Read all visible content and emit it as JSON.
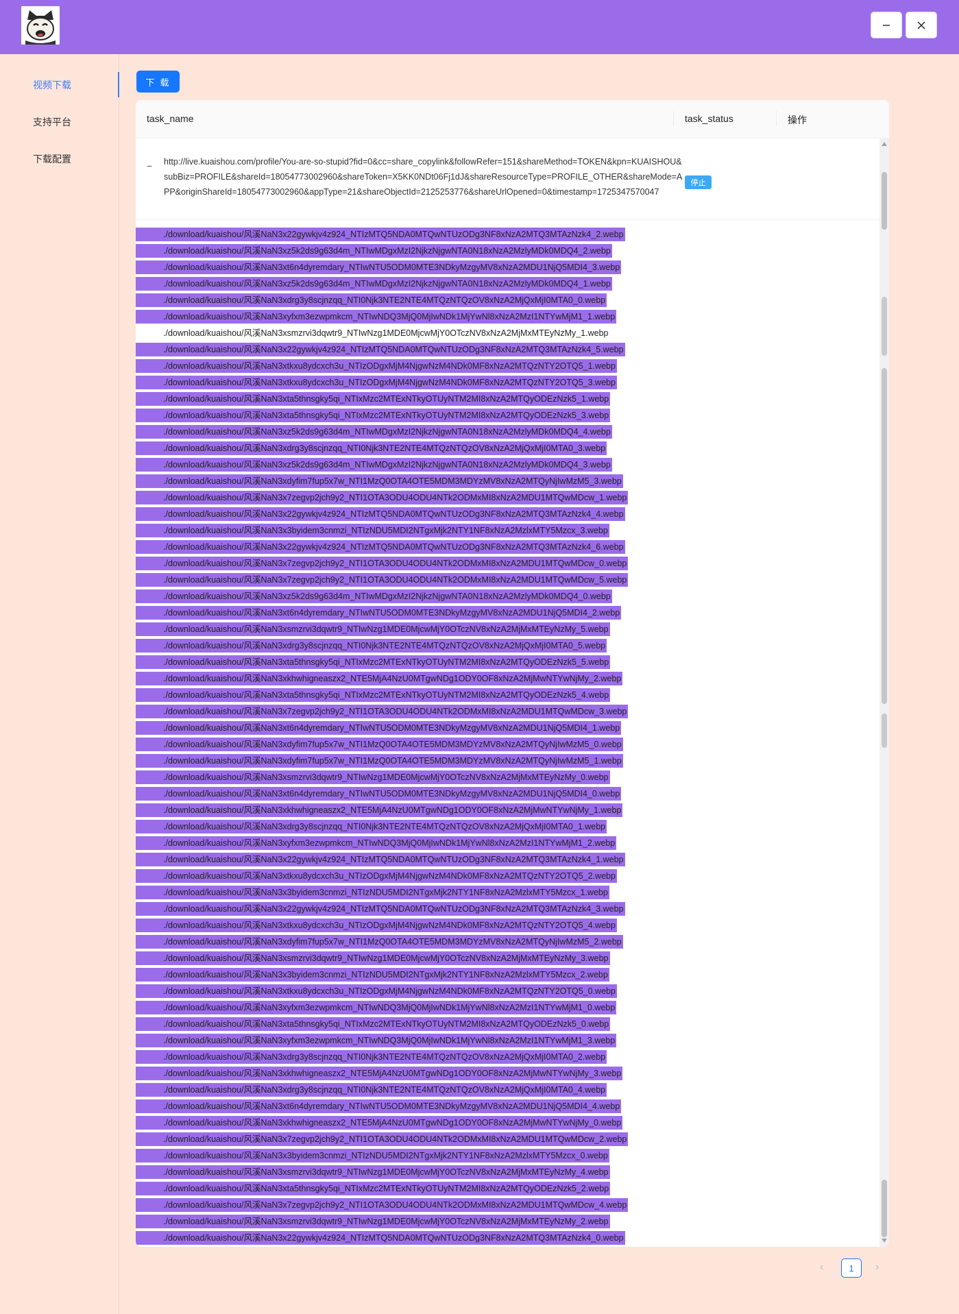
{
  "header": {
    "close_icon": "close-icon",
    "minimize_icon": "minimize-icon"
  },
  "sidebar": {
    "items": [
      {
        "label": "视频下载",
        "active": true
      },
      {
        "label": "支持平台",
        "active": false
      },
      {
        "label": "下载配置",
        "active": false
      }
    ]
  },
  "toolbar": {
    "download_label": "下 载"
  },
  "table": {
    "columns": [
      "task_name",
      "task_status",
      "操作"
    ],
    "task": {
      "name": "http://live.kuaishou.com/profile/You-are-so-stupid?fid=0&cc=share_copylink&followRefer=151&shareMethod=TOKEN&kpn=KUAISHOU&subBiz=PROFILE&shareId=18054773002960&shareToken=X5KK0NDt06Fj1dJ&shareResourceType=PROFILE_OTHER&shareMode=APP&originShareId=18054773002960&appType=21&shareObjectId=2125253776&shareUrlOpened=0&timestamp=1725347570047",
      "status": "停止",
      "collapse_symbol": "−"
    },
    "files": [
      {
        "path": "./download/kuaishou/风溪NaN3x22gywkjv4z924_NTIzMTQ5NDA0MTQwNTUzODg3NF8xNzA2MTQ3MTAzNzk4_2.webp",
        "selected": true
      },
      {
        "path": "./download/kuaishou/风溪NaN3xz5k2ds9g63d4m_NTIwMDgxMzI2NjkzNjgwNTA0N18xNzA2MzlyMDk0MDQ4_2.webp",
        "selected": true
      },
      {
        "path": "./download/kuaishou/风溪NaN3xt6n4dyremdary_NTIwNTU5ODM0MTE3NDkyMzgyMV8xNzA2MDU1NjQ5MDI4_3.webp",
        "selected": true
      },
      {
        "path": "./download/kuaishou/风溪NaN3xz5k2ds9g63d4m_NTIwMDgxMzI2NjkzNjgwNTA0N18xNzA2MzlyMDk0MDQ4_1.webp",
        "selected": true
      },
      {
        "path": "./download/kuaishou/风溪NaN3xdrg3y8scjnzqq_NTI0Njk3NTE2NTE4MTQzNTQzOV8xNzA2MjQxMjI0MTA0_0.webp",
        "selected": true
      },
      {
        "path": "./download/kuaishou/风溪NaN3xyfxm3ezwpmkcm_NTIwNDQ3MjQ0MjIwNDk1MjYwNl8xNzA2MzI1NTYwMjM1_1.webp",
        "selected": true
      },
      {
        "path": "./download/kuaishou/风溪NaN3xsmzrvi3dqwtr9_NTIwNzg1MDE0MjcwMjY0OTczNV8xNzA2MjMxMTEyNzMy_1.webp",
        "selected": false
      },
      {
        "path": "./download/kuaishou/风溪NaN3x22gywkjv4z924_NTIzMTQ5NDA0MTQwNTUzODg3NF8xNzA2MTQ3MTAzNzk4_5.webp",
        "selected": true
      },
      {
        "path": "./download/kuaishou/风溪NaN3xtkxu8ydcxch3u_NTIzODgxMjM4NjgwNzM4NDk0MF8xNzA2MTQzNTY2OTQ5_1.webp",
        "selected": true
      },
      {
        "path": "./download/kuaishou/风溪NaN3xtkxu8ydcxch3u_NTIzODgxMjM4NjgwNzM4NDk0MF8xNzA2MTQzNTY2OTQ5_3.webp",
        "selected": true
      },
      {
        "path": "./download/kuaishou/风溪NaN3xta5thnsgky5qi_NTIxMzc2MTExNTkyOTUyNTM2MI8xNzA2MTQyODEzNzk5_1.webp",
        "selected": true
      },
      {
        "path": "./download/kuaishou/风溪NaN3xta5thnsgky5qi_NTIxMzc2MTExNTkyOTUyNTM2MI8xNzA2MTQyODEzNzk5_3.webp",
        "selected": true
      },
      {
        "path": "./download/kuaishou/风溪NaN3xz5k2ds9g63d4m_NTIwMDgxMzI2NjkzNjgwNTA0N18xNzA2MzlyMDk0MDQ4_4.webp",
        "selected": true
      },
      {
        "path": "./download/kuaishou/风溪NaN3xdrg3y8scjnzqq_NTI0Njk3NTE2NTE4MTQzNTQzOV8xNzA2MjQxMjI0MTA0_3.webp",
        "selected": true
      },
      {
        "path": "./download/kuaishou/风溪NaN3xz5k2ds9g63d4m_NTIwMDgxMzI2NjkzNjgwNTA0N18xNzA2MzlyMDk0MDQ4_3.webp",
        "selected": true
      },
      {
        "path": "./download/kuaishou/风溪NaN3xdyfim7fup5x7w_NTI1MzQ0OTA4OTE5MDM3MDYzMV8xNzA2MTQyNjIwMzM5_3.webp",
        "selected": true
      },
      {
        "path": "./download/kuaishou/风溪NaN3x7zegvp2jch9y2_NTI1OTA3ODU4ODU4NTk2ODMxMI8xNzA2MDU1MTQwMDcw_1.webp",
        "selected": true
      },
      {
        "path": "./download/kuaishou/风溪NaN3x22gywkjv4z924_NTIzMTQ5NDA0MTQwNTUzODg3NF8xNzA2MTQ3MTAzNzk4_4.webp",
        "selected": true
      },
      {
        "path": "./download/kuaishou/风溪NaN3x3byidem3cnmzi_NTIzNDU5MDI2NTgxMjk2NTY1NF8xNzA2MzlxMTY5Mzcx_3.webp",
        "selected": true
      },
      {
        "path": "./download/kuaishou/风溪NaN3x22gywkjv4z924_NTIzMTQ5NDA0MTQwNTUzODg3NF8xNzA2MTQ3MTAzNzk4_6.webp",
        "selected": true
      },
      {
        "path": "./download/kuaishou/风溪NaN3x7zegvp2jch9y2_NTI1OTA3ODU4ODU4NTk2ODMxMI8xNzA2MDU1MTQwMDcw_0.webp",
        "selected": true
      },
      {
        "path": "./download/kuaishou/风溪NaN3x7zegvp2jch9y2_NTI1OTA3ODU4ODU4NTk2ODMxMI8xNzA2MDU1MTQwMDcw_5.webp",
        "selected": true
      },
      {
        "path": "./download/kuaishou/风溪NaN3xz5k2ds9g63d4m_NTIwMDgxMzI2NjkzNjgwNTA0N18xNzA2MzlyMDk0MDQ4_0.webp",
        "selected": true
      },
      {
        "path": "./download/kuaishou/风溪NaN3xt6n4dyremdary_NTIwNTU5ODM0MTE3NDkyMzgyMV8xNzA2MDU1NjQ5MDI4_2.webp",
        "selected": true
      },
      {
        "path": "./download/kuaishou/风溪NaN3xsmzrvi3dqwtr9_NTIwNzg1MDE0MjcwMjY0OTczNV8xNzA2MjMxMTEyNzMy_5.webp",
        "selected": true
      },
      {
        "path": "./download/kuaishou/风溪NaN3xdrg3y8scjnzqq_NTI0Njk3NTE2NTE4MTQzNTQzOV8xNzA2MjQxMjI0MTA0_5.webp",
        "selected": true
      },
      {
        "path": "./download/kuaishou/风溪NaN3xta5thnsgky5qi_NTIxMzc2MTExNTkyOTUyNTM2MI8xNzA2MTQyODEzNzk5_5.webp",
        "selected": true
      },
      {
        "path": "./download/kuaishou/风溪NaN3xkhwhigneaszx2_NTE5MjA4NzU0MTgwNDg1ODY0OF8xNzA2MjMwNTYwNjMy_2.webp",
        "selected": true
      },
      {
        "path": "./download/kuaishou/风溪NaN3xta5thnsgky5qi_NTIxMzc2MTExNTkyOTUyNTM2MI8xNzA2MTQyODEzNzk5_4.webp",
        "selected": true
      },
      {
        "path": "./download/kuaishou/风溪NaN3x7zegvp2jch9y2_NTI1OTA3ODU4ODU4NTk2ODMxMI8xNzA2MDU1MTQwMDcw_3.webp",
        "selected": true
      },
      {
        "path": "./download/kuaishou/风溪NaN3xt6n4dyremdary_NTIwNTU5ODM0MTE3NDkyMzgyMV8xNzA2MDU1NjQ5MDI4_1.webp",
        "selected": true
      },
      {
        "path": "./download/kuaishou/风溪NaN3xdyfim7fup5x7w_NTI1MzQ0OTA4OTE5MDM3MDYzMV8xNzA2MTQyNjIwMzM5_0.webp",
        "selected": true
      },
      {
        "path": "./download/kuaishou/风溪NaN3xdyfim7fup5x7w_NTI1MzQ0OTA4OTE5MDM3MDYzMV8xNzA2MTQyNjIwMzM5_1.webp",
        "selected": true
      },
      {
        "path": "./download/kuaishou/风溪NaN3xsmzrvi3dqwtr9_NTIwNzg1MDE0MjcwMjY0OTczNV8xNzA2MjMxMTEyNzMy_0.webp",
        "selected": true
      },
      {
        "path": "./download/kuaishou/风溪NaN3xt6n4dyremdary_NTIwNTU5ODM0MTE3NDkyMzgyMV8xNzA2MDU1NjQ5MDI4_0.webp",
        "selected": true
      },
      {
        "path": "./download/kuaishou/风溪NaN3xkhwhigneaszx2_NTE5MjA4NzU0MTgwNDg1ODY0OF8xNzA2MjMwNTYwNjMy_1.webp",
        "selected": true
      },
      {
        "path": "./download/kuaishou/风溪NaN3xdrg3y8scjnzqq_NTI0Njk3NTE2NTE4MTQzNTQzOV8xNzA2MjQxMjI0MTA0_1.webp",
        "selected": true
      },
      {
        "path": "./download/kuaishou/风溪NaN3xyfxm3ezwpmkcm_NTIwNDQ3MjQ0MjIwNDk1MjYwNl8xNzA2MzI1NTYwMjM1_2.webp",
        "selected": true
      },
      {
        "path": "./download/kuaishou/风溪NaN3x22gywkjv4z924_NTIzMTQ5NDA0MTQwNTUzODg3NF8xNzA2MTQ3MTAzNzk4_1.webp",
        "selected": true
      },
      {
        "path": "./download/kuaishou/风溪NaN3xtkxu8ydcxch3u_NTIzODgxMjM4NjgwNzM4NDk0MF8xNzA2MTQzNTY2OTQ5_2.webp",
        "selected": true
      },
      {
        "path": "./download/kuaishou/风溪NaN3x3byidem3cnmzi_NTIzNDU5MDI2NTgxMjk2NTY1NF8xNzA2MzlxMTY5Mzcx_1.webp",
        "selected": true
      },
      {
        "path": "./download/kuaishou/风溪NaN3x22gywkjv4z924_NTIzMTQ5NDA0MTQwNTUzODg3NF8xNzA2MTQ3MTAzNzk4_3.webp",
        "selected": true
      },
      {
        "path": "./download/kuaishou/风溪NaN3xtkxu8ydcxch3u_NTIzODgxMjM4NjgwNzM4NDk0MF8xNzA2MTQzNTY2OTQ5_4.webp",
        "selected": true
      },
      {
        "path": "./download/kuaishou/风溪NaN3xdyfim7fup5x7w_NTI1MzQ0OTA4OTE5MDM3MDYzMV8xNzA2MTQyNjIwMzM5_2.webp",
        "selected": true
      },
      {
        "path": "./download/kuaishou/风溪NaN3xsmzrvi3dqwtr9_NTIwNzg1MDE0MjcwMjY0OTczNV8xNzA2MjMxMTEyNzMy_3.webp",
        "selected": true
      },
      {
        "path": "./download/kuaishou/风溪NaN3x3byidem3cnmzi_NTIzNDU5MDI2NTgxMjk2NTY1NF8xNzA2MzlxMTY5Mzcx_2.webp",
        "selected": true
      },
      {
        "path": "./download/kuaishou/风溪NaN3xtkxu8ydcxch3u_NTIzODgxMjM4NjgwNzM4NDk0MF8xNzA2MTQzNTY2OTQ5_0.webp",
        "selected": true
      },
      {
        "path": "./download/kuaishou/风溪NaN3xyfxm3ezwpmkcm_NTIwNDQ3MjQ0MjIwNDk1MjYwNl8xNzA2MzI1NTYwMjM1_0.webp",
        "selected": true
      },
      {
        "path": "./download/kuaishou/风溪NaN3xta5thnsgky5qi_NTIxMzc2MTExNTkyOTUyNTM2MI8xNzA2MTQyODEzNzk5_0.webp",
        "selected": true
      },
      {
        "path": "./download/kuaishou/风溪NaN3xyfxm3ezwpmkcm_NTIwNDQ3MjQ0MjIwNDk1MjYwNl8xNzA2MzI1NTYwMjM1_3.webp",
        "selected": true
      },
      {
        "path": "./download/kuaishou/风溪NaN3xdrg3y8scjnzqq_NTI0Njk3NTE2NTE4MTQzNTQzOV8xNzA2MjQxMjI0MTA0_2.webp",
        "selected": true
      },
      {
        "path": "./download/kuaishou/风溪NaN3xkhwhigneaszx2_NTE5MjA4NzU0MTgwNDg1ODY0OF8xNzA2MjMwNTYwNjMy_3.webp",
        "selected": true
      },
      {
        "path": "./download/kuaishou/风溪NaN3xdrg3y8scjnzqq_NTI0Njk3NTE2NTE4MTQzNTQzOV8xNzA2MjQxMjI0MTA0_4.webp",
        "selected": true
      },
      {
        "path": "./download/kuaishou/风溪NaN3xt6n4dyremdary_NTIwNTU5ODM0MTE3NDkyMzgyMV8xNzA2MDU1NjQ5MDI4_4.webp",
        "selected": true
      },
      {
        "path": "./download/kuaishou/风溪NaN3xkhwhigneaszx2_NTE5MjA4NzU0MTgwNDg1ODY0OF8xNzA2MjMwNTYwNjMy_0.webp",
        "selected": true
      },
      {
        "path": "./download/kuaishou/风溪NaN3x7zegvp2jch9y2_NTI1OTA3ODU4ODU4NTk2ODMxMI8xNzA2MDU1MTQwMDcw_2.webp",
        "selected": true
      },
      {
        "path": "./download/kuaishou/风溪NaN3x3byidem3cnmzi_NTIzNDU5MDI2NTgxMjk2NTY1NF8xNzA2MzlxMTY5Mzcx_0.webp",
        "selected": true
      },
      {
        "path": "./download/kuaishou/风溪NaN3xsmzrvi3dqwtr9_NTIwNzg1MDE0MjcwMjY0OTczNV8xNzA2MjMxMTEyNzMy_4.webp",
        "selected": true
      },
      {
        "path": "./download/kuaishou/风溪NaN3xta5thnsgky5qi_NTIxMzc2MTExNTkyOTUyNTM2MI8xNzA2MTQyODEzNzk5_2.webp",
        "selected": true
      },
      {
        "path": "./download/kuaishou/风溪NaN3x7zegvp2jch9y2_NTI1OTA3ODU4ODU4NTk2ODMxMI8xNzA2MDU1MTQwMDcw_4.webp",
        "selected": true
      },
      {
        "path": "./download/kuaishou/风溪NaN3xsmzrvi3dqwtr9_NTIwNzg1MDE0MjcwMjY0OTczNV8xNzA2MjMxMTEyNzMy_2.webp",
        "selected": true
      },
      {
        "path": "./download/kuaishou/风溪NaN3x22gywkjv4z924_NTIzMTQ5NDA0MTQwNTUzODg3NF8xNzA2MTQ3MTAzNzk4_0.webp",
        "selected": true
      }
    ]
  },
  "pagination": {
    "current": "1",
    "prev": "‹",
    "next": "›"
  },
  "colors": {
    "header": "#9b6cea",
    "background": "#fde5da",
    "accent": "#1677ff",
    "selection": "#9b6cea",
    "status_tag": "#3da9f5"
  }
}
